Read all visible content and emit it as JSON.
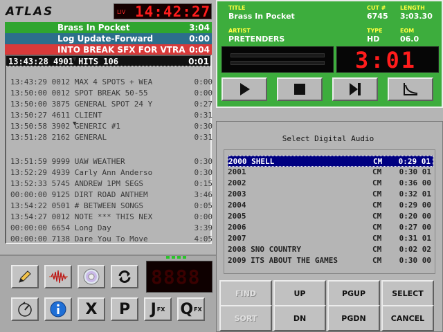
{
  "brand": {
    "logo": "ATLAS"
  },
  "clock": {
    "mode": "LIV",
    "time": "14:42:27"
  },
  "queue": [
    {
      "title": "Brass In Pocket",
      "dur": "3:04",
      "color": "#2fa52f"
    },
    {
      "title": "Log Update-Forward",
      "dur": "0:00",
      "color": "#2c6e8c"
    },
    {
      "title": "INTO BREAK SFX FOR VTRA",
      "dur": "0:04",
      "color": "#d83a3a"
    },
    {
      "title": "13:43:28 4901 HITS 106",
      "dur": "0:01",
      "color": "#111111"
    }
  ],
  "log": [
    {
      "text": "13:43:29 0012 MAX 4 SPOTS + WEA",
      "dur": "0:00"
    },
    {
      "text": "13:50:00 0012 SPOT BREAK 50-55",
      "dur": "0:00"
    },
    {
      "text": "13:50:00 3875 GENERAL SPOT 24 Y",
      "dur": "0:27"
    },
    {
      "text": "13:50:27 4611 CLIENT",
      "dur": "0:31"
    },
    {
      "text": "13:50:58 3902 GENERIC #1",
      "dur": "0:30"
    },
    {
      "text": "13:51:28 2162 GENERAL",
      "dur": "0:31"
    },
    {
      "text": "13:51:59 9999 UAW WEATHER",
      "dur": "0:30"
    },
    {
      "text": "13:52:29 4939 Carly Ann Anderso",
      "dur": "0:30"
    },
    {
      "text": "13:52:33 5745 ANDREW 1PM SEGS",
      "dur": "0:15"
    },
    {
      "text": "00:00:00 9125 DIRT ROAD ANTHEM",
      "dur": "3:46"
    },
    {
      "text": "13:54:22 0501 # BETWEEN SONGS",
      "dur": "0:05"
    },
    {
      "text": "13:54:27 0012 NOTE *** THIS NEX",
      "dur": "0:00"
    },
    {
      "text": "00:00:00 6654 Long Day",
      "dur": "3:39"
    },
    {
      "text": "00:00:00 7138 Dare You To Move",
      "dur": "4:05"
    }
  ],
  "tools": {
    "icons": [
      "pencil-icon",
      "waveform-icon",
      "cd-icon",
      "refresh-icon",
      "meter-icon",
      "info-icon"
    ],
    "x_label": "X",
    "p_label": "P",
    "j_label": "J",
    "q_label": "Q",
    "fx_label": "FX"
  },
  "led": {
    "value": "8888"
  },
  "now": {
    "title_label": "TITLE",
    "title": "Brass In Pocket",
    "cut_label": "CUT #",
    "cut": "6745",
    "length_label": "LENGTH",
    "length": "3:03.30",
    "artist_label": "ARTIST",
    "artist": "PRETENDERS",
    "type_label": "TYPE",
    "type": "HD",
    "eom_label": "EOM",
    "eom": "06.0",
    "countdown": "3:01"
  },
  "select": {
    "title": "Select Digital Audio",
    "rows": [
      {
        "cut": "2000 SHELL",
        "cat": "CM",
        "dur": "0:29 01"
      },
      {
        "cut": "2001",
        "cat": "CM",
        "dur": "0:30 01"
      },
      {
        "cut": "2002",
        "cat": "CM",
        "dur": "0:36 00"
      },
      {
        "cut": "2003",
        "cat": "CM",
        "dur": "0:32 01"
      },
      {
        "cut": "2004",
        "cat": "CM",
        "dur": "0:29 00"
      },
      {
        "cut": "2005",
        "cat": "CM",
        "dur": "0:20 00"
      },
      {
        "cut": "2006",
        "cat": "CM",
        "dur": "0:27 00"
      },
      {
        "cut": "2007",
        "cat": "CM",
        "dur": "0:31 01"
      },
      {
        "cut": "2008 SNO COUNTRY",
        "cat": "CM",
        "dur": "0:02 02"
      },
      {
        "cut": "2009 ITS ABOUT THE GAMES",
        "cat": "CM",
        "dur": "0:30 00"
      }
    ],
    "buttons": {
      "find": "FIND",
      "up": "UP",
      "pgup": "PGUP",
      "select": "SELECT",
      "sort": "SORT",
      "dn": "DN",
      "pgdn": "PGDN",
      "cancel": "CANCEL"
    }
  }
}
